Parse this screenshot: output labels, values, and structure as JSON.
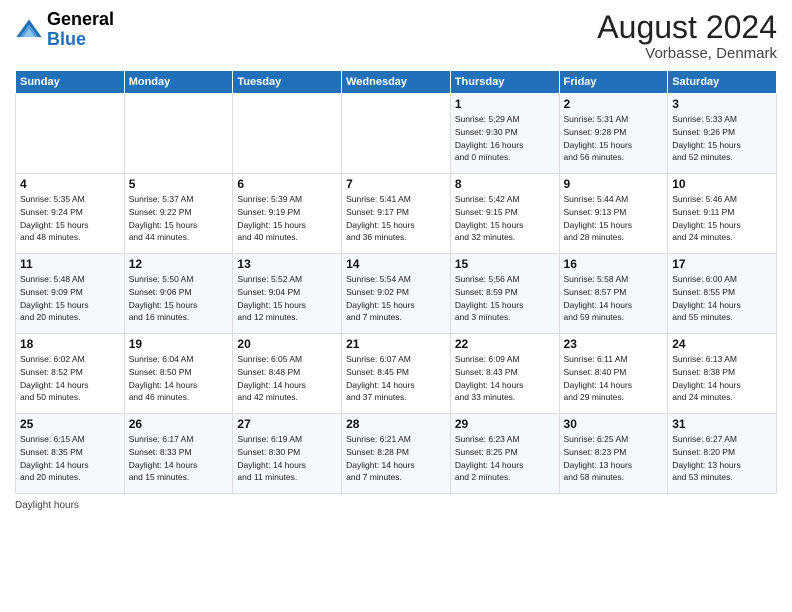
{
  "header": {
    "logo_general": "General",
    "logo_blue": "Blue",
    "month_title": "August 2024",
    "location": "Vorbasse, Denmark"
  },
  "days_of_week": [
    "Sunday",
    "Monday",
    "Tuesday",
    "Wednesday",
    "Thursday",
    "Friday",
    "Saturday"
  ],
  "weeks": [
    [
      {
        "day": "",
        "info": ""
      },
      {
        "day": "",
        "info": ""
      },
      {
        "day": "",
        "info": ""
      },
      {
        "day": "",
        "info": ""
      },
      {
        "day": "1",
        "info": "Sunrise: 5:29 AM\nSunset: 9:30 PM\nDaylight: 16 hours\nand 0 minutes."
      },
      {
        "day": "2",
        "info": "Sunrise: 5:31 AM\nSunset: 9:28 PM\nDaylight: 15 hours\nand 56 minutes."
      },
      {
        "day": "3",
        "info": "Sunrise: 5:33 AM\nSunset: 9:26 PM\nDaylight: 15 hours\nand 52 minutes."
      }
    ],
    [
      {
        "day": "4",
        "info": "Sunrise: 5:35 AM\nSunset: 9:24 PM\nDaylight: 15 hours\nand 48 minutes."
      },
      {
        "day": "5",
        "info": "Sunrise: 5:37 AM\nSunset: 9:22 PM\nDaylight: 15 hours\nand 44 minutes."
      },
      {
        "day": "6",
        "info": "Sunrise: 5:39 AM\nSunset: 9:19 PM\nDaylight: 15 hours\nand 40 minutes."
      },
      {
        "day": "7",
        "info": "Sunrise: 5:41 AM\nSunset: 9:17 PM\nDaylight: 15 hours\nand 36 minutes."
      },
      {
        "day": "8",
        "info": "Sunrise: 5:42 AM\nSunset: 9:15 PM\nDaylight: 15 hours\nand 32 minutes."
      },
      {
        "day": "9",
        "info": "Sunrise: 5:44 AM\nSunset: 9:13 PM\nDaylight: 15 hours\nand 28 minutes."
      },
      {
        "day": "10",
        "info": "Sunrise: 5:46 AM\nSunset: 9:11 PM\nDaylight: 15 hours\nand 24 minutes."
      }
    ],
    [
      {
        "day": "11",
        "info": "Sunrise: 5:48 AM\nSunset: 9:09 PM\nDaylight: 15 hours\nand 20 minutes."
      },
      {
        "day": "12",
        "info": "Sunrise: 5:50 AM\nSunset: 9:06 PM\nDaylight: 15 hours\nand 16 minutes."
      },
      {
        "day": "13",
        "info": "Sunrise: 5:52 AM\nSunset: 9:04 PM\nDaylight: 15 hours\nand 12 minutes."
      },
      {
        "day": "14",
        "info": "Sunrise: 5:54 AM\nSunset: 9:02 PM\nDaylight: 15 hours\nand 7 minutes."
      },
      {
        "day": "15",
        "info": "Sunrise: 5:56 AM\nSunset: 8:59 PM\nDaylight: 15 hours\nand 3 minutes."
      },
      {
        "day": "16",
        "info": "Sunrise: 5:58 AM\nSunset: 8:57 PM\nDaylight: 14 hours\nand 59 minutes."
      },
      {
        "day": "17",
        "info": "Sunrise: 6:00 AM\nSunset: 8:55 PM\nDaylight: 14 hours\nand 55 minutes."
      }
    ],
    [
      {
        "day": "18",
        "info": "Sunrise: 6:02 AM\nSunset: 8:52 PM\nDaylight: 14 hours\nand 50 minutes."
      },
      {
        "day": "19",
        "info": "Sunrise: 6:04 AM\nSunset: 8:50 PM\nDaylight: 14 hours\nand 46 minutes."
      },
      {
        "day": "20",
        "info": "Sunrise: 6:05 AM\nSunset: 8:48 PM\nDaylight: 14 hours\nand 42 minutes."
      },
      {
        "day": "21",
        "info": "Sunrise: 6:07 AM\nSunset: 8:45 PM\nDaylight: 14 hours\nand 37 minutes."
      },
      {
        "day": "22",
        "info": "Sunrise: 6:09 AM\nSunset: 8:43 PM\nDaylight: 14 hours\nand 33 minutes."
      },
      {
        "day": "23",
        "info": "Sunrise: 6:11 AM\nSunset: 8:40 PM\nDaylight: 14 hours\nand 29 minutes."
      },
      {
        "day": "24",
        "info": "Sunrise: 6:13 AM\nSunset: 8:38 PM\nDaylight: 14 hours\nand 24 minutes."
      }
    ],
    [
      {
        "day": "25",
        "info": "Sunrise: 6:15 AM\nSunset: 8:35 PM\nDaylight: 14 hours\nand 20 minutes."
      },
      {
        "day": "26",
        "info": "Sunrise: 6:17 AM\nSunset: 8:33 PM\nDaylight: 14 hours\nand 15 minutes."
      },
      {
        "day": "27",
        "info": "Sunrise: 6:19 AM\nSunset: 8:30 PM\nDaylight: 14 hours\nand 11 minutes."
      },
      {
        "day": "28",
        "info": "Sunrise: 6:21 AM\nSunset: 8:28 PM\nDaylight: 14 hours\nand 7 minutes."
      },
      {
        "day": "29",
        "info": "Sunrise: 6:23 AM\nSunset: 8:25 PM\nDaylight: 14 hours\nand 2 minutes."
      },
      {
        "day": "30",
        "info": "Sunrise: 6:25 AM\nSunset: 8:23 PM\nDaylight: 13 hours\nand 58 minutes."
      },
      {
        "day": "31",
        "info": "Sunrise: 6:27 AM\nSunset: 8:20 PM\nDaylight: 13 hours\nand 53 minutes."
      }
    ]
  ],
  "footer": {
    "daylight_label": "Daylight hours"
  }
}
